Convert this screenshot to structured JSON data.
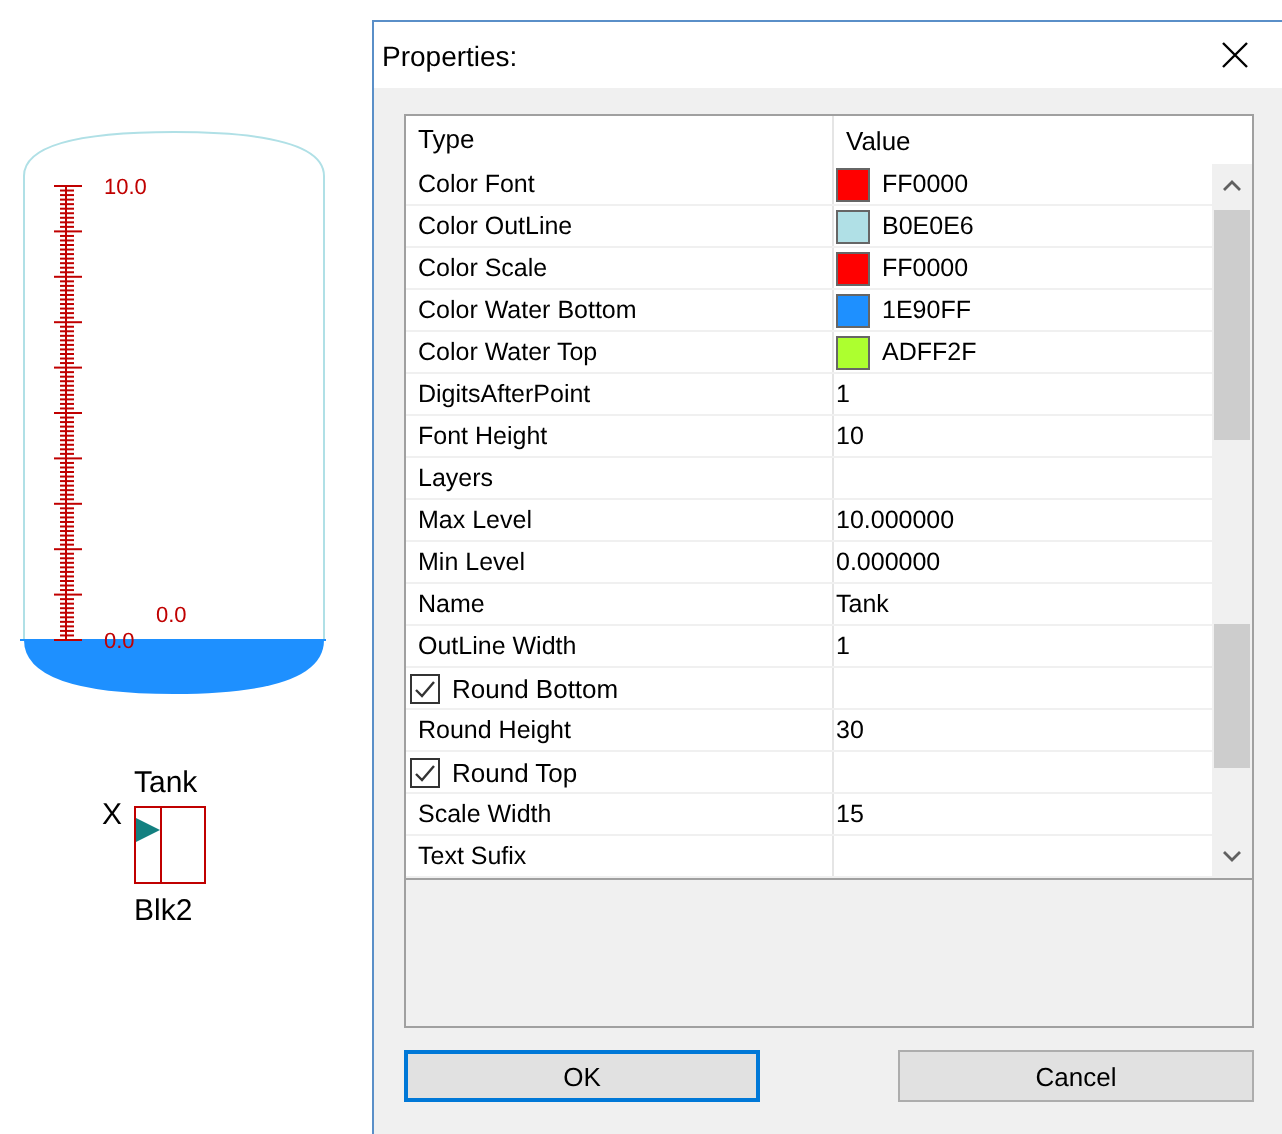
{
  "canvas": {
    "tank": {
      "scale_max": "10.0",
      "level_label": "0.0",
      "scale_min": "0.0"
    },
    "block": {
      "title": "Tank",
      "port": "X",
      "name": "Blk2"
    }
  },
  "dialog": {
    "title": "Properties:",
    "grid": {
      "columns": [
        "Type",
        "Value"
      ],
      "rows": [
        {
          "kind": "color",
          "name": "Color Font",
          "value": "FF0000",
          "color": "#ff0000"
        },
        {
          "kind": "color",
          "name": "Color OutLine",
          "value": "B0E0E6",
          "color": "#b0e0e6"
        },
        {
          "kind": "color",
          "name": "Color Scale",
          "value": "FF0000",
          "color": "#ff0000"
        },
        {
          "kind": "color",
          "name": "Color Water Bottom",
          "value": "1E90FF",
          "color": "#1e90ff"
        },
        {
          "kind": "color",
          "name": "Color Water Top",
          "value": "ADFF2F",
          "color": "#adff2f"
        },
        {
          "kind": "text",
          "name": "DigitsAfterPoint",
          "value": "1"
        },
        {
          "kind": "text",
          "name": "Font Height",
          "value": "10"
        },
        {
          "kind": "text",
          "name": "Layers"
        },
        {
          "kind": "text",
          "name": "Max Level",
          "value": "10.000000"
        },
        {
          "kind": "text",
          "name": "Min Level",
          "value": "0.000000"
        },
        {
          "kind": "text",
          "name": "Name",
          "value": "Tank"
        },
        {
          "kind": "text",
          "name": "OutLine Width",
          "value": "1"
        },
        {
          "kind": "check",
          "name": "Round Bottom",
          "checked": true
        },
        {
          "kind": "text",
          "name": "Round Height",
          "value": "30"
        },
        {
          "kind": "check",
          "name": "Round Top",
          "checked": true
        },
        {
          "kind": "text",
          "name": "Scale Width",
          "value": "15"
        },
        {
          "kind": "text",
          "name": "Text Sufix"
        }
      ]
    },
    "buttons": [
      {
        "label": "OK",
        "selected": true
      },
      {
        "label": "Cancel",
        "selected": false
      }
    ]
  }
}
